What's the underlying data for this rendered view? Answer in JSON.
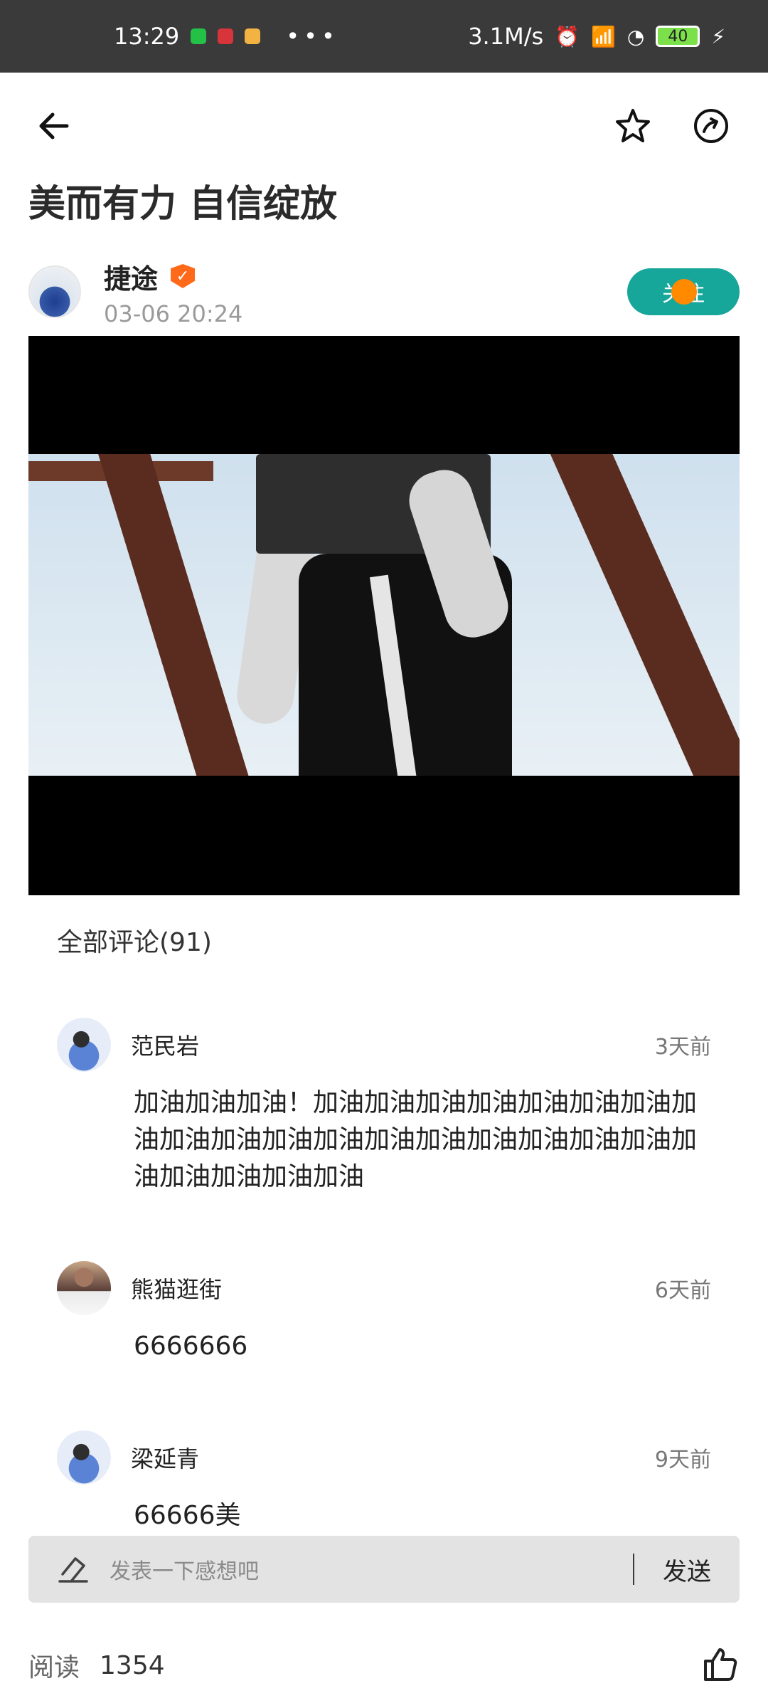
{
  "status_bar": {
    "time": "13:29",
    "network_speed": "3.1M/s",
    "battery": "40",
    "more": "•••"
  },
  "nav": {
    "back_icon": "arrow-left-icon",
    "favorite_icon": "star-icon",
    "share_icon": "share-icon"
  },
  "post": {
    "title": "美而有力 自信绽放",
    "author_name": "捷途",
    "timestamp": "03-06 20:24",
    "follow_label": "关注",
    "verified_icon": "verified-badge-icon"
  },
  "comments": {
    "header": "全部评论(91)",
    "items": [
      {
        "user": "范民岩",
        "time": "3天前",
        "text": "加油加油加油！加油加油加油加油加油加油加油加油加油加油加油加油加油加油加油加油加油加油加油加油加油加油加油"
      },
      {
        "user": "熊猫逛街",
        "time": "6天前",
        "text": "6666666"
      },
      {
        "user": "梁延青",
        "time": "9天前",
        "text": "66666美"
      }
    ]
  },
  "input": {
    "placeholder": "发表一下感想吧",
    "send_label": "发送",
    "edit_icon": "edit-icon"
  },
  "footer": {
    "read_label": "阅读",
    "read_count": "1354",
    "like_icon": "thumbs-up-icon"
  }
}
